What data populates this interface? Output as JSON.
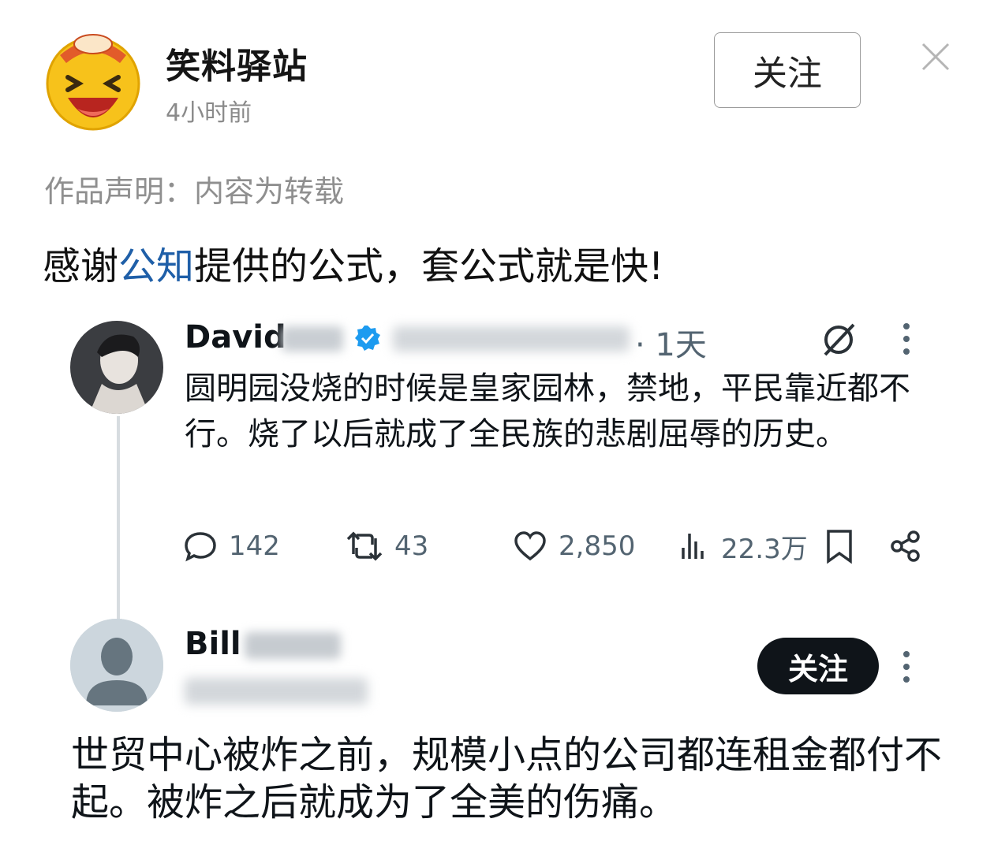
{
  "header": {
    "account_name": "笑料驿站",
    "time": "4小时前",
    "follow_label": "关注"
  },
  "declaration": "作品声明：内容为转载",
  "post": {
    "text_before": "感谢",
    "mention": "公知",
    "text_after": "提供的公式，套公式就是快!"
  },
  "tweet1": {
    "name_visible": "David",
    "time": "· 1天",
    "body": "圆明园没烧的时候是皇家园林，禁地，平民靠近都不行。烧了以后就成了全民族的悲剧屈辱的历史。",
    "stats": {
      "replies": "142",
      "retweets": "43",
      "likes": "2,850",
      "views": "22.3万"
    }
  },
  "tweet2": {
    "name_visible": "Bill",
    "follow_label": "关注",
    "body": "世贸中心被炸之前，规模小点的公司都连租金都付不起。被炸之后就成为了全美的伤痛。"
  },
  "colors": {
    "mention": "#1f5fa8",
    "verified": "#1d9bf0",
    "follow_dark": "#0f1419",
    "secondary_text": "#536471"
  }
}
